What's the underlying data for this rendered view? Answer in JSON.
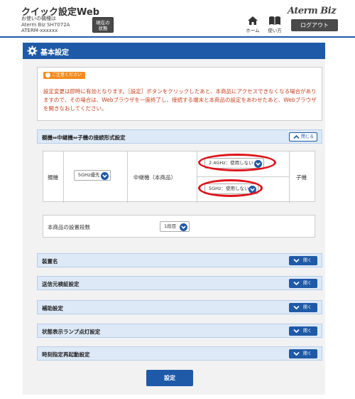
{
  "header": {
    "app_title": "クイック設定Web",
    "device_info_line1": "お使いの機種は",
    "device_info_line2": "Aterm Biz SH7072A",
    "device_info_line3": "ATERM-xxxxxx",
    "status_button_line1": "現在の",
    "status_button_line2": "状態",
    "brand": "Aterm Biz",
    "home_label": "ホーム",
    "manual_label": "使い方",
    "logout_label": "ログアウト"
  },
  "page": {
    "title": "基本設定"
  },
  "notice": {
    "badge": "ご注意ください",
    "text": "設定変更は即時に有効となります。［設定］ボタンをクリックしたあと、本商品にアクセスできなくなる場合がありますので、その場合は、Webブラウザを一度終了し、接続する端末と本商品の設定をあわせたあと、Webブラウザを開きなおしてください。"
  },
  "connection_section": {
    "title": "親機⇔中継機⇔子機の接続形式設定",
    "close_label": "閉じる",
    "parent_label": "親機",
    "parent_select": "5GHz優先",
    "repeater_label": "中継機（本商品）",
    "repeater_24_select": "2.4GHz：使用しない",
    "repeater_5_select": "5GHz：使用しない",
    "child_label": "子機"
  },
  "install_stage": {
    "label": "本商品の設置段数",
    "select": "1段目"
  },
  "collapsed_sections": [
    {
      "title": "装置名",
      "open_label": "開く"
    },
    {
      "title": "送信元検証設定",
      "open_label": "開く"
    },
    {
      "title": "補助設定",
      "open_label": "開く"
    },
    {
      "title": "状態表示ランプ点灯設定",
      "open_label": "開く"
    },
    {
      "title": "時刻指定再起動設定",
      "open_label": "開く"
    }
  ],
  "submit_label": "設定",
  "colors": {
    "primary": "#1f5aa8",
    "notice_text": "#c8411e",
    "notice_badge": "#f28c1e",
    "highlight": "#e0121a",
    "section_bg": "#dde9f7"
  },
  "icons": {
    "home": "home-icon",
    "manual": "book-icon",
    "gear": "gear-icon",
    "chevron": "chevron-down-icon"
  }
}
